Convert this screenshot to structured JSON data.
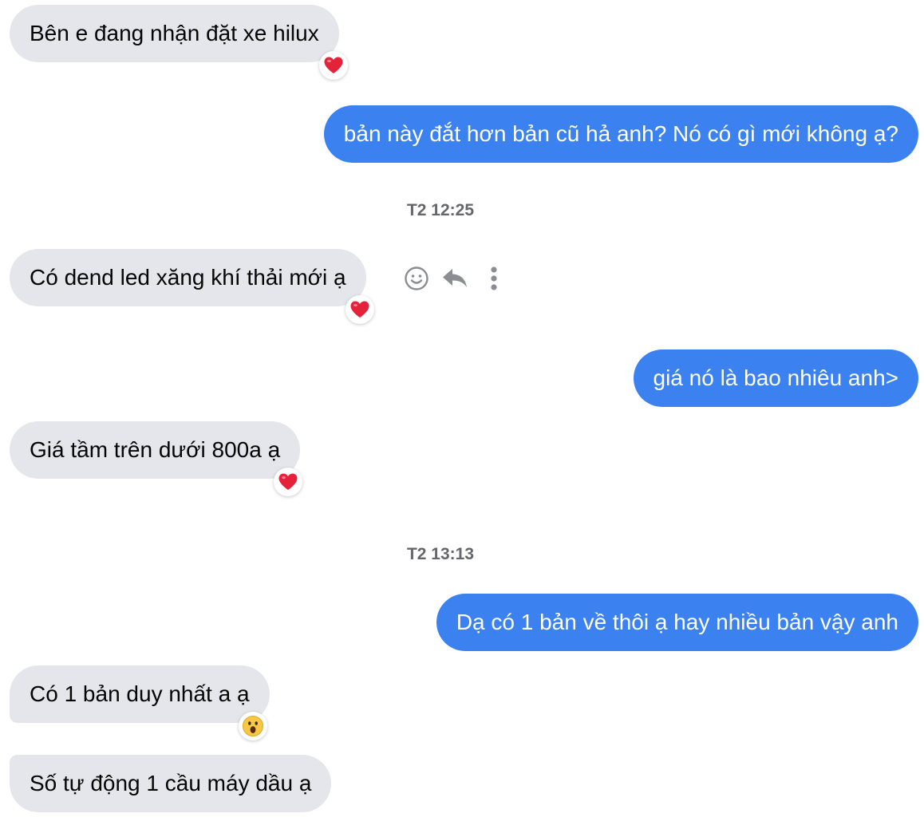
{
  "messages": [
    {
      "id": "m1",
      "side": "in",
      "text": "Bên e đang nhận đặt xe hilux",
      "reaction": "heart"
    },
    {
      "id": "m2",
      "side": "out",
      "text": "bản này đắt hơn bản cũ hả anh? Nó có gì mới không ạ?"
    },
    {
      "id": "m3",
      "side": "in",
      "text": "Có dend led xăng khí thải mới ạ",
      "reaction": "heart"
    },
    {
      "id": "m4",
      "side": "out",
      "text": "giá nó là bao nhiêu anh>"
    },
    {
      "id": "m5",
      "side": "in",
      "text": "Giá tầm trên dưới 800a ạ",
      "reaction": "heart"
    },
    {
      "id": "m6",
      "side": "out",
      "text": "Dạ có 1 bản về thôi ạ hay nhiều bản vậy anh"
    },
    {
      "id": "m7",
      "side": "in",
      "text": "Có 1 bản duy nhất a ạ",
      "reaction": "wow"
    },
    {
      "id": "m8",
      "side": "in",
      "text": "Số tự động 1 cầu máy dầu ạ"
    }
  ],
  "timestamps": [
    "T2 12:25",
    "T2 13:13"
  ],
  "hover_actions": [
    "react-icon",
    "reply-icon",
    "more-options-icon"
  ],
  "colors": {
    "incoming_bubble": "#e4e6eb",
    "outgoing_bubble": "#3b82f0",
    "incoming_text": "#050505",
    "outgoing_text": "#ffffff",
    "timestamp_text": "#65676b",
    "action_icon": "#8a8d91",
    "heart": "#e4233b"
  }
}
